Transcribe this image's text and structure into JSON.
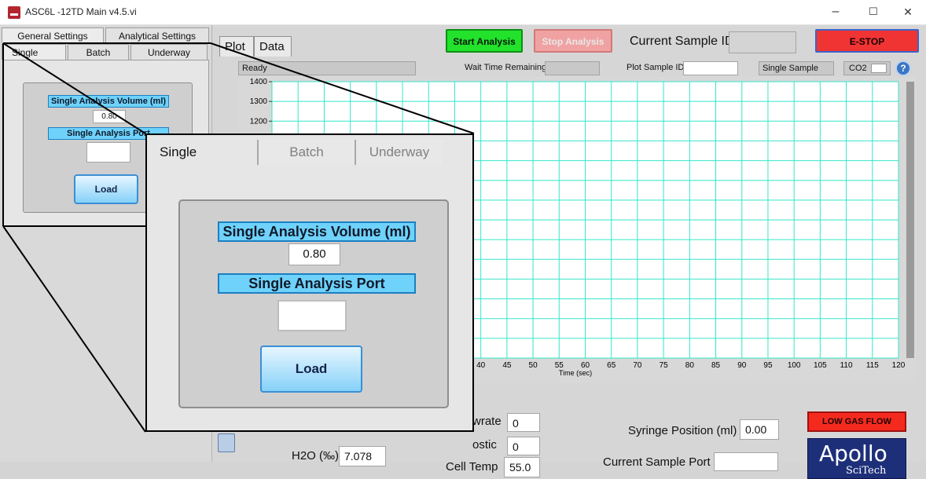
{
  "window": {
    "title": "ASC6L -12TD Main v4.5.vi",
    "minimize": "–",
    "maximize": "☐",
    "close": "✕"
  },
  "settings": {
    "top_tabs": [
      "General Settings",
      "Analytical Settings"
    ],
    "sub_tabs": [
      "Single",
      "Batch",
      "Underway"
    ],
    "volume_label": "Single Analysis Volume (ml)",
    "volume_value": "0.80",
    "port_label": "Single Analysis Port",
    "port_value": "",
    "load_label": "Load"
  },
  "zoom": {
    "tabs": [
      "Single",
      "Batch",
      "Underway"
    ],
    "volume_label": "Single Analysis Volume (ml)",
    "volume_value": "0.80",
    "port_label": "Single Analysis Port",
    "port_value": "",
    "load_label": "Load"
  },
  "main": {
    "tabs": [
      "Plot",
      "Data"
    ],
    "start_label": "Start Analysis",
    "stop_label": "Stop Analysis",
    "current_sample_label": "Current Sample ID",
    "current_sample_value": "",
    "estop_label": "E-STOP",
    "status_text": "Ready",
    "wait_label": "Wait Time Remaining",
    "wait_value": "",
    "plot_sample_label": "Plot Sample ID",
    "plot_sample_value": "",
    "mode_value": "Single Sample",
    "gas_value": "CO2",
    "help_icon": "?"
  },
  "bottom": {
    "flowrate_label": "wrate",
    "flowrate_value": "0",
    "diagnostic_label": "ostic",
    "diagnostic_value": "0",
    "h2o_label": "H2O (‰)",
    "h2o_value": "7.078",
    "celltemp_label": "Cell Temp",
    "celltemp_value": "55.0",
    "syringe_label": "Syringe Position (ml)",
    "syringe_value": "0.00",
    "port_label": "Current Sample Port",
    "port_value": "",
    "low_gas_label": "LOW GAS FLOW",
    "logo_main": "Apollo",
    "logo_sub": "SciTech"
  },
  "colors": {
    "grid": "#35e6c8",
    "start_green": "#22e22c",
    "estop_red": "#f03434",
    "label_blue": "#6ed2fb"
  },
  "chart_data": {
    "type": "line",
    "xlabel": "Time (sec)",
    "ylabel": "",
    "x_ticks_visible": [
      40,
      45,
      50,
      55,
      60,
      65,
      70,
      75,
      80,
      85,
      90,
      95,
      100,
      105,
      110,
      115,
      120
    ],
    "y_ticks_visible": [
      1400,
      1300,
      1200
    ],
    "xlim": [
      0,
      120
    ],
    "ylim": [
      0,
      1400
    ],
    "grid": true,
    "series": []
  }
}
